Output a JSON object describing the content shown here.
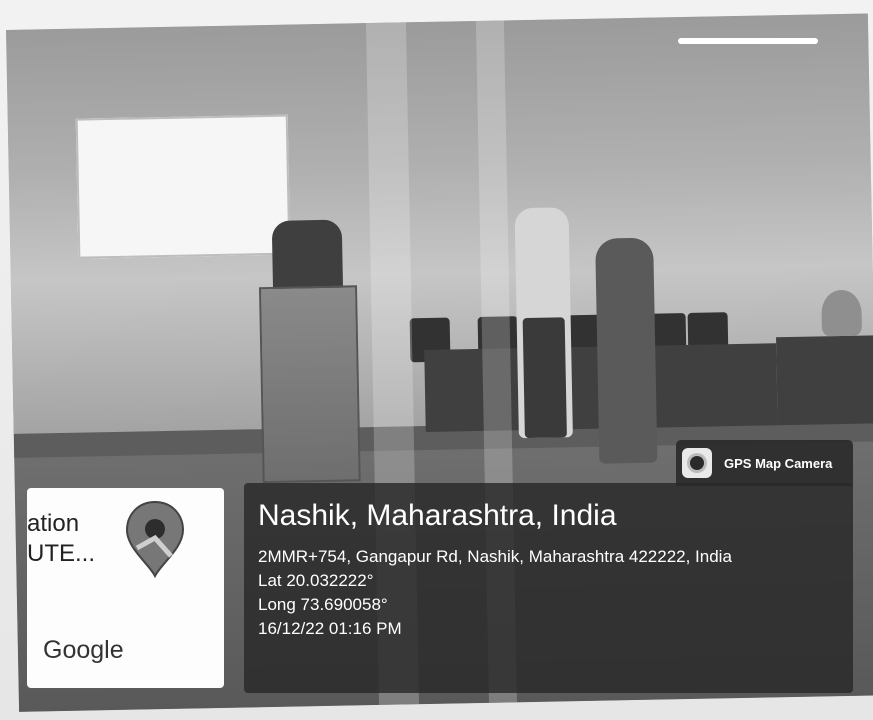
{
  "overlay": {
    "badge": {
      "label": "GPS Map Camera",
      "icon": "camera-icon"
    },
    "location": {
      "title": "Nashik, Maharashtra, India",
      "address": "2MMR+754, Gangapur Rd, Nashik, Maharashtra 422222, India",
      "latitude": "Lat 20.032222°",
      "longitude": "Long 73.690058°",
      "datetime": "16/12/22 01:16 PM"
    },
    "map_card": {
      "line1": "ation",
      "line2": "UTE...",
      "brand": "Google",
      "pin_icon": "map-pin-icon"
    }
  }
}
